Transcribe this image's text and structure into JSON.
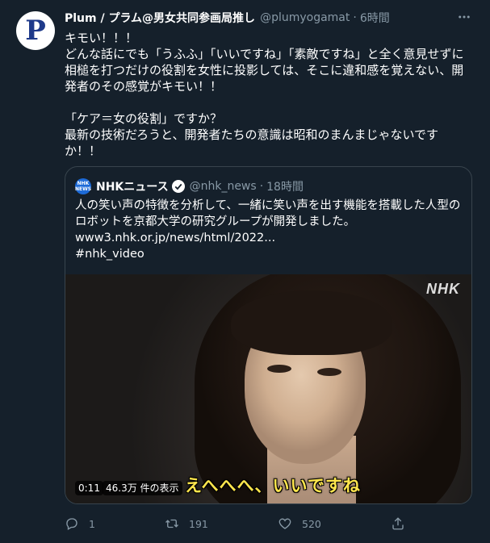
{
  "tweet": {
    "avatar_letter": "P",
    "author_name": "Plum / プラム@男女共同参画局推し",
    "handle": "@plumyogamat",
    "separator": "·",
    "time": "6時間",
    "text": "キモい！！！\nどんな話にでも「うふふ」「いいですね」「素敵ですね」と全く意見せずに相槌を打つだけの役割を女性に投影しては、そこに違和感を覚えない、開発者のその感覚がキモい！！\n\n「ケア＝女の役割」ですか？\n最新の技術だろうと、開発者たちの意識は昭和のまんまじゃないですか！！"
  },
  "quote": {
    "logo_text": "NHK\nNEWS",
    "author_name": "NHKニュース",
    "handle": "@nhk_news",
    "separator": "·",
    "time": "18時間",
    "text": "人の笑い声の特徴を分析して、一緒に笑い声を出す機能を搭載した人型のロボットを京都大学の研究グループが開発しました。\nwww3.nhk.or.jp/news/html/2022...\n#nhk_video",
    "video": {
      "watermark": "NHK",
      "subtitle": "えへへへ、いいですね",
      "duration": "0:11",
      "views": "46.3万 件の表示"
    }
  },
  "actions": {
    "reply_count": "1",
    "retweet_count": "191",
    "like_count": "520"
  },
  "icons": {
    "more": "more-icon",
    "verified": "verified-icon",
    "reply": "reply-icon",
    "retweet": "retweet-icon",
    "like": "like-icon",
    "share": "share-icon"
  },
  "colors": {
    "background": "#15202b",
    "secondary_text": "#8899a6",
    "border": "#38444d",
    "subtitle": "#ffe64d"
  }
}
